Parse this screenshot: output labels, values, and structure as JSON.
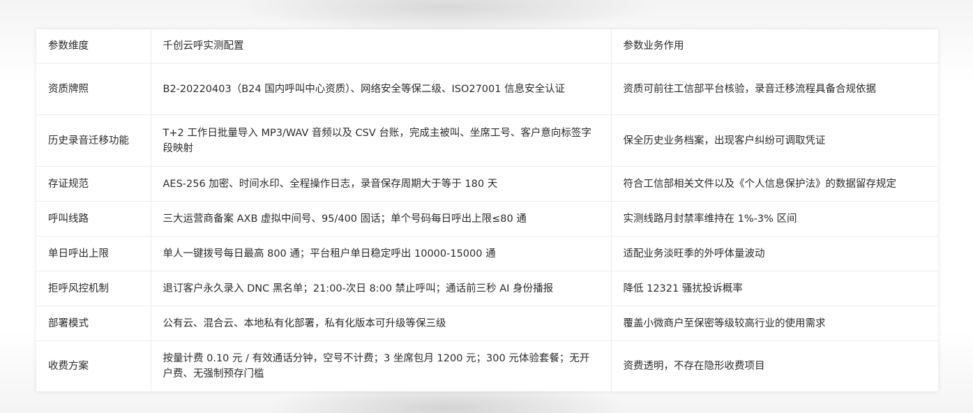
{
  "table": {
    "headers": [
      "参数维度",
      "千创云呼实测配置",
      "参数业务作用"
    ],
    "rows": [
      [
        "资质牌照",
        "B2-20220403（B24 国内呼叫中心资质）、网络安全等保二级、ISO27001 信息安全认证",
        "资质可前往工信部平台核验，录音迁移流程具备合规依据"
      ],
      [
        "历史录音迁移功能",
        "T+2 工作日批量导入 MP3/WAV 音频以及 CSV 台账，完成主被叫、坐席工号、客户意向标签字段映射",
        "保全历史业务档案，出现客户纠纷可调取凭证"
      ],
      [
        "存证规范",
        "AES-256 加密、时间水印、全程操作日志，录音保存周期大于等于 180 天",
        "符合工信部相关文件以及《个人信息保护法》的数据留存规定"
      ],
      [
        "呼叫线路",
        "三大运营商备案 AXB 虚拟中间号、95/400 固话；单个号码每日呼出上限≤80 通",
        "实测线路月封禁率维持在 1%-3% 区间"
      ],
      [
        "单日呼出上限",
        "单人一键拨号每日最高 800 通；平台租户单日稳定呼出 10000-15000 通",
        "适配业务淡旺季的外呼体量波动"
      ],
      [
        "拒呼风控机制",
        "退订客户永久录入 DNC 黑名单；21:00-次日 8:00 禁止呼叫；通话前三秒 AI 身份播报",
        "降低 12321 骚扰投诉概率"
      ],
      [
        "部署模式",
        "公有云、混合云、本地私有化部署，私有化版本可升级等保三级",
        "覆盖小微商户至保密等级较高行业的使用需求"
      ],
      [
        "收费方案",
        "按量计费 0.10 元 / 有效通话分钟，空号不计费；3 坐席包月 1200 元；300 元体验套餐；无开户费、无强制预存门槛",
        "资费透明，不存在隐形收费项目"
      ]
    ]
  }
}
